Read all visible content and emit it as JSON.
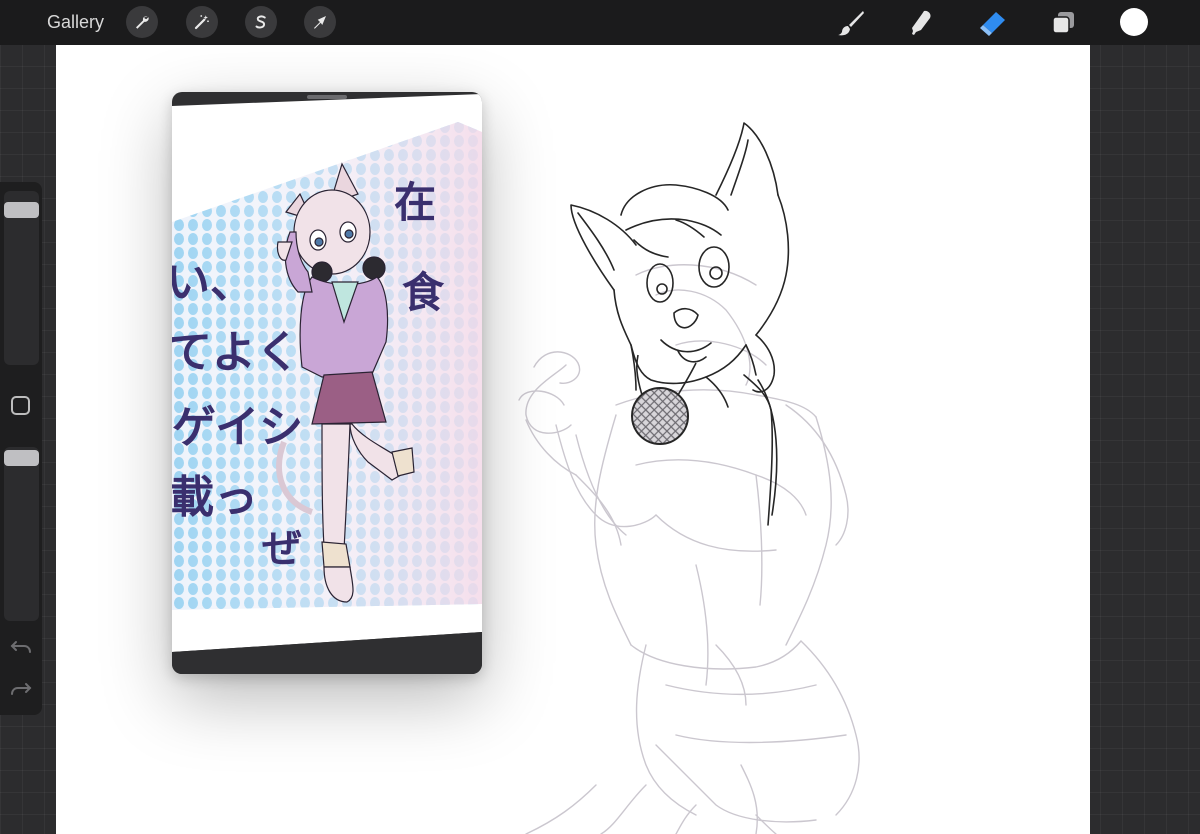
{
  "topbar": {
    "gallery_label": "Gallery",
    "left_tools": [
      {
        "icon": "wrench-icon",
        "name": "actions"
      },
      {
        "icon": "magic-wand-icon",
        "name": "adjustments"
      },
      {
        "icon": "selection-s-icon",
        "name": "selection"
      },
      {
        "icon": "arrow-cursor-icon",
        "name": "transform"
      }
    ],
    "right_tools": [
      {
        "icon": "brush-icon",
        "name": "paint",
        "active": false
      },
      {
        "icon": "smudge-icon",
        "name": "smudge",
        "active": false
      },
      {
        "icon": "eraser-icon",
        "name": "erase",
        "active": true
      },
      {
        "icon": "layers-icon",
        "name": "layers",
        "active": false
      }
    ],
    "current_color": "#ffffff"
  },
  "sidebar": {
    "brush_size_level": 0.95,
    "opacity_level": 1.0
  },
  "reference": {
    "japanese_text": [
      "い、",
      "てよく",
      "ゲイシ",
      "載っ",
      "ぜ",
      "在",
      "食"
    ]
  },
  "colors": {
    "active_tool": "#2f8cf0",
    "toolbar_bg": "#1b1b1c",
    "canvas_bg": "#ffffff",
    "sketch_line": "#c9c5cd",
    "ink_line": "#2a2a2a"
  }
}
